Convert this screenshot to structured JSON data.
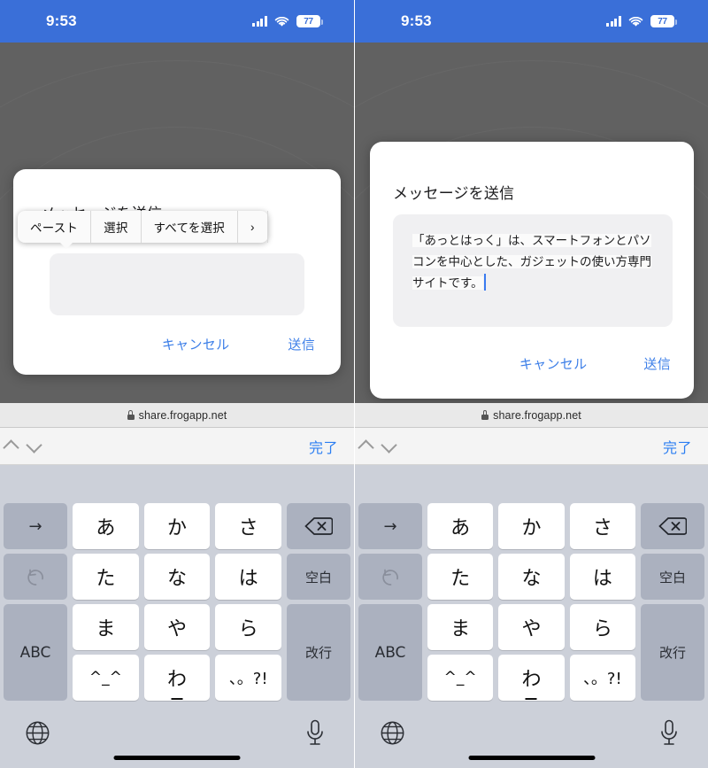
{
  "status_bar": {
    "time": "9:53",
    "battery_percent": "77",
    "signal_icon": "cellular-signal-icon",
    "wifi_icon": "wifi-icon",
    "battery_icon": "battery-icon",
    "background_color": "#3a6fd8"
  },
  "dialog": {
    "title": "メッセージを送信",
    "cancel_label": "キャンセル",
    "send_label": "送信",
    "accent_color": "#3d7fe8",
    "left_field_value": "",
    "right_field_value": "「あっとはっく」は、スマートフォンとパソコンを中心とした、ガジェットの使い方専門サイトです。"
  },
  "context_menu": {
    "items": [
      {
        "label": "ペースト",
        "name": "paste"
      },
      {
        "label": "選択",
        "name": "select"
      },
      {
        "label": "すべてを選択",
        "name": "select-all"
      },
      {
        "label": "›",
        "name": "more"
      }
    ]
  },
  "browser": {
    "url": "share.frogapp.net",
    "lock_icon": "lock-icon"
  },
  "accessory_bar": {
    "prev_icon": "chevron-up-icon",
    "next_icon": "chevron-down-icon",
    "done_label": "完了",
    "done_color": "#2b7ef2"
  },
  "keyboard": {
    "type": "japanese-kana-10key",
    "keys": {
      "cursor_right": "→",
      "undo": "↺",
      "abc": "ABC",
      "a": "あ",
      "ka": "か",
      "sa": "さ",
      "ta": "た",
      "na": "な",
      "ha": "は",
      "ma": "ま",
      "ya": "や",
      "ra": "ら",
      "emoticon": "^_^",
      "wa": "わ",
      "punct": "、。?!",
      "delete": "⌫",
      "space": "空白",
      "return": "改行"
    },
    "bottom": {
      "globe_icon": "globe-icon",
      "mic_icon": "microphone-icon"
    },
    "background_color": "#ccd0d9",
    "function_key_color": "#abb1bf",
    "char_key_color": "#ffffff"
  }
}
